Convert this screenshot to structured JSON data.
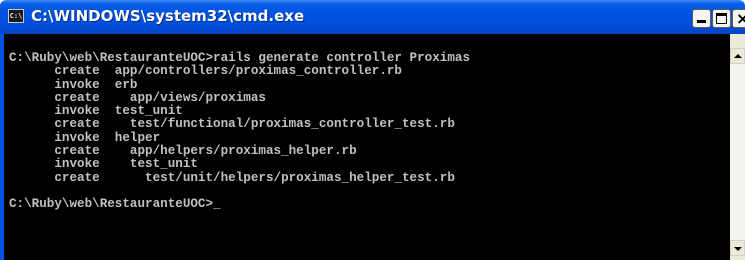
{
  "window": {
    "title": "C:\\WINDOWS\\system32\\cmd.exe",
    "icon_text": "C:\\"
  },
  "controls": {
    "minimize": "minimize-icon",
    "maximize": "maximize-icon",
    "close_label": "×"
  },
  "console": {
    "lines": [
      "C:\\Ruby\\web\\RestauranteUOC>rails generate controller Proximas",
      "      create  app/controllers/proximas_controller.rb",
      "      invoke  erb",
      "      create    app/views/proximas",
      "      invoke  test_unit",
      "      create    test/functional/proximas_controller_test.rb",
      "      invoke  helper",
      "      create    app/helpers/proximas_helper.rb",
      "      invoke    test_unit",
      "      create      test/unit/helpers/proximas_helper_test.rb",
      "",
      "C:\\Ruby\\web\\RestauranteUOC>"
    ],
    "cursor": "_"
  },
  "colors": {
    "titlebar": "#0054e3",
    "console_bg": "#000000",
    "console_fg": "#c0c0c0"
  }
}
